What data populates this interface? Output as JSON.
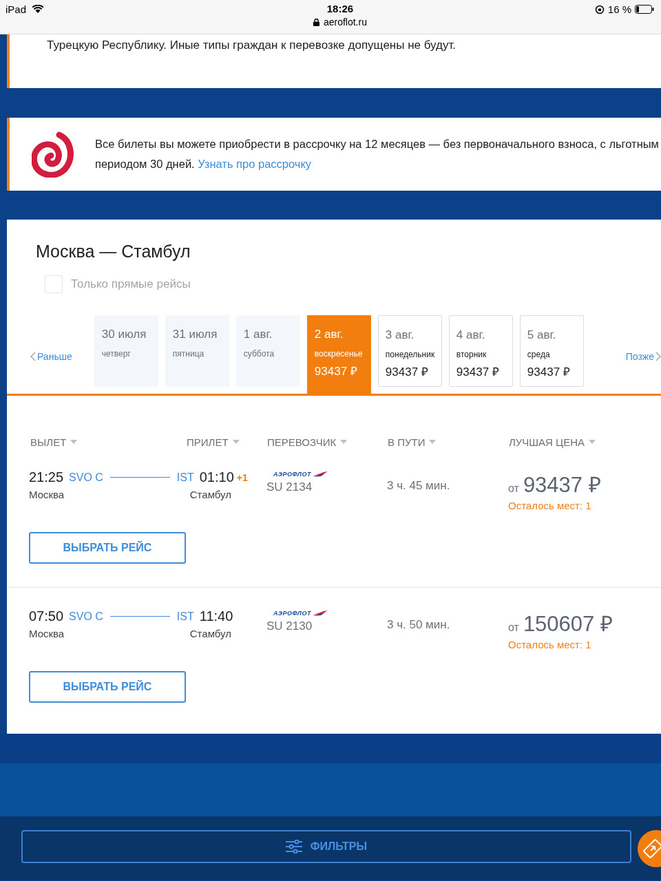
{
  "status_bar": {
    "device": "iPad",
    "time": "18:26",
    "url": "aeroflot.ru",
    "battery": "16 %"
  },
  "notice": {
    "text": "Турецкую Республику. Иные типы граждан к перевозке допущены не будут."
  },
  "installment": {
    "text": "Все билеты вы можете приобрести в рассрочку на 12 месяцев — без первоначального взноса, с льготным периодом 30 дней.",
    "link": "Узнать про рассрочку"
  },
  "route": {
    "title": "Москва — Стамбул",
    "direct_only": {
      "label": "Только прямые рейсы",
      "checked": false
    }
  },
  "dates": {
    "earlier": "Раньше",
    "later": "Позже",
    "items": [
      {
        "date": "30 июля",
        "weekday": "четверг",
        "available": false,
        "selected": false
      },
      {
        "date": "31 июля",
        "weekday": "пятница",
        "available": false,
        "selected": false
      },
      {
        "date": "1 авг.",
        "weekday": "суббота",
        "available": false,
        "selected": false
      },
      {
        "date": "2 авг.",
        "weekday": "воскресенье",
        "price": "93437 ₽",
        "available": true,
        "selected": true
      },
      {
        "date": "3 авг.",
        "weekday": "понедельник",
        "price": "93437 ₽",
        "available": true,
        "selected": false
      },
      {
        "date": "4 авг.",
        "weekday": "вторник",
        "price": "93437 ₽",
        "available": true,
        "selected": false
      },
      {
        "date": "5 авг.",
        "weekday": "среда",
        "price": "93437 ₽",
        "available": true,
        "selected": false
      }
    ]
  },
  "columns": [
    "ВЫЛЕТ",
    "ПРИЛЕТ",
    "ПЕРЕВОЗЧИК",
    "В ПУТИ",
    "ЛУЧШАЯ ЦЕНА"
  ],
  "flights": [
    {
      "dep_time": "21:25",
      "dep_code": "SVO C",
      "dep_city": "Москва",
      "arr_code": "IST",
      "arr_time": "01:10",
      "day_shift": "+1",
      "arr_city": "Стамбул",
      "carrier": "АЭРОФЛОТ",
      "flight_no": "SU 2134",
      "duration": "3 ч. 45 мин.",
      "price_prefix": "от",
      "price": "93437 ₽",
      "seats": "Осталось мест: 1",
      "button": "ВЫБРАТЬ РЕЙС"
    },
    {
      "dep_time": "07:50",
      "dep_code": "SVO C",
      "dep_city": "Москва",
      "arr_code": "IST",
      "arr_time": "11:40",
      "arr_city": "Стамбул",
      "carrier": "АЭРОФЛОТ",
      "flight_no": "SU 2130",
      "duration": "3 ч. 50 мин.",
      "price_prefix": "от",
      "price": "150607 ₽",
      "seats": "Осталось мест: 1",
      "button": "ВЫБРАТЬ РЕЙС"
    }
  ],
  "filters_button": "ФИЛЬТРЫ"
}
